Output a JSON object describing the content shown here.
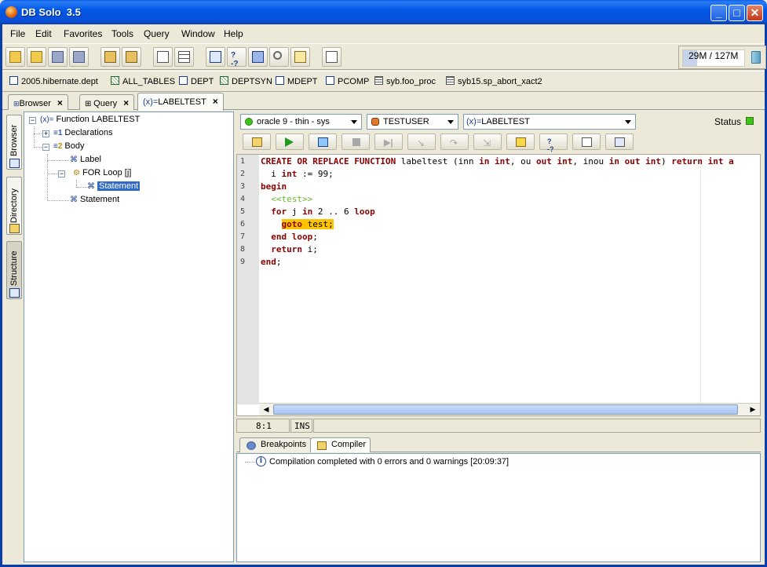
{
  "window": {
    "title": "DB Solo  3.5"
  },
  "menu": [
    "File",
    "Edit",
    "Favorites",
    "Tools",
    "Query",
    "Window",
    "Help"
  ],
  "toolbar": {
    "icons": [
      "open-folder-icon",
      "open-multiple-icon",
      "save-icon",
      "save-all-icon",
      "connect-icon",
      "disconnect-icon",
      "tree-icon",
      "table-icon",
      "schema-icon",
      "query-help-icon",
      "export-icon",
      "search-icon",
      "report-icon",
      "edit-icon"
    ],
    "memory": {
      "label": "29M / 127M",
      "used_fraction": 0.228
    }
  },
  "favorites": [
    {
      "label": "2005.hibernate.dept",
      "icon": "table-icon"
    },
    {
      "label": "ALL_TABLES",
      "icon": "multi-table-icon"
    },
    {
      "label": "DEPT",
      "icon": "table-icon"
    },
    {
      "label": "DEPTSYN",
      "icon": "multi-table-icon"
    },
    {
      "label": "MDEPT",
      "icon": "table-icon"
    },
    {
      "label": "PCOMP",
      "icon": "table-icon"
    },
    {
      "label": "syb.foo_proc",
      "icon": "procedure-icon"
    },
    {
      "label": "syb15.sp_abort_xact2",
      "icon": "procedure-icon"
    }
  ],
  "tabs": [
    {
      "label": "Browser"
    },
    {
      "label": "Query"
    },
    {
      "label": "LABELTEST",
      "prefix": "(x)="
    }
  ],
  "dock": [
    "Browser",
    "Directory",
    "Structure"
  ],
  "tree": {
    "root": "Function LABELTEST",
    "declarations": "Declarations",
    "body": "Body",
    "label_node": "Label",
    "for_loop": "FOR Loop [j]",
    "statement_inner": "Statement",
    "statement_outer": "Statement",
    "prefix_func": "(x)=",
    "num_1": "1",
    "num_2": "2"
  },
  "editor_toolbar": {
    "connection": "oracle 9 - thin - sys",
    "schema": "TESTUSER",
    "object": "LABELTEST",
    "object_prefix": "(x)=",
    "status_label": "Status"
  },
  "code": {
    "line_numbers": [
      "1",
      "2",
      "3",
      "4",
      "5",
      "6",
      "7",
      "8",
      "9"
    ]
  },
  "editor_status": {
    "position": "8:1",
    "mode": "INS"
  },
  "bottom": {
    "tabs": [
      "Breakpoints",
      "Compiler"
    ],
    "message": "Compilation completed with 0 errors and 0 warnings [20:09:37]"
  }
}
